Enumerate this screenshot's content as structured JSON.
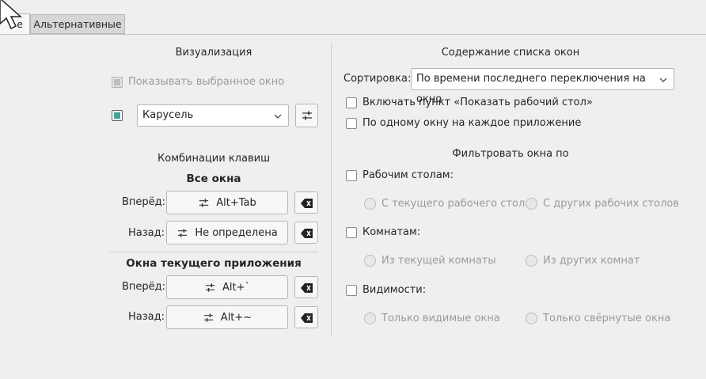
{
  "tabs": {
    "active_label": "е",
    "inactive_label": "Альтернативные"
  },
  "left": {
    "visualization_header": "Визуализация",
    "show_selected_label": "Показывать выбранное окно",
    "style_combo_value": "Карусель",
    "shortcuts_header": "Комбинации клавиш",
    "all_windows_header": "Все окна",
    "forward_label": "Вперёд:",
    "back_label": "Назад:",
    "all_forward_key": "Alt+Tab",
    "all_back_key": "Не определена",
    "current_app_header": "Окна текущего приложения",
    "app_forward_label": "Вперёд:",
    "app_back_label": "Назад:",
    "app_forward_key": "Alt+`",
    "app_back_key": "Alt+~"
  },
  "right": {
    "content_header": "Содержание списка окон",
    "sort_label": "Сортировка:",
    "sort_value": "По времени последнего переключения на окно",
    "include_desktop_label": "Включать пункт «Показать рабочий стол»",
    "one_per_app_label": "По одному окну на каждое приложение",
    "filter_header": "Фильтровать окна по",
    "desktops_label": "Рабочим столам:",
    "desktop_current": "С текущего рабочего стола",
    "desktop_other": "С других рабочих столов",
    "activities_label": "Комнатам:",
    "activity_current": "Из текущей комнаты",
    "activity_other": "Из других комнат",
    "visibility_label": "Видимости:",
    "visible_only": "Только видимые окна",
    "minimized_only": "Только свёрнутые окна"
  },
  "icons": {
    "configure": "sliders-icon",
    "clear": "backspace-clear-icon",
    "accent_color": "#3fa39a"
  }
}
